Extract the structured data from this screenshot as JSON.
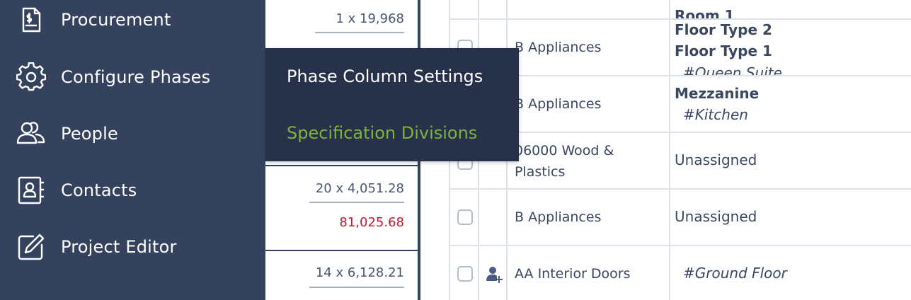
{
  "sidebar": {
    "items": [
      {
        "label": "Procurement",
        "icon": "procurement-document-icon"
      },
      {
        "label": "Configure Phases",
        "icon": "gear-icon"
      },
      {
        "label": "People",
        "icon": "people-icon"
      },
      {
        "label": "Contacts",
        "icon": "contact-book-icon"
      },
      {
        "label": "Project Editor",
        "icon": "edit-icon"
      }
    ]
  },
  "popup_menu": {
    "items": [
      {
        "label": "Phase Column Settings",
        "color": "#ffffff"
      },
      {
        "label": "Specification Divisions",
        "color": "#7fb13f"
      }
    ]
  },
  "costs": {
    "row0_qty": "1 x 19,968",
    "row3_qty": "20 x 4,051.28",
    "row3_total": "81,025.68",
    "row4_qty": "14 x 6,128.21"
  },
  "table": {
    "row0": {
      "location_bold": "Room 1"
    },
    "row1": {
      "division": "B Appliances",
      "location_bold_1": "Floor Type 2",
      "location_bold_2": "Floor Type 1",
      "location_tag": "#Queen Suite"
    },
    "row2": {
      "division": "B Appliances",
      "location_bold": "Mezzanine",
      "location_tag": "#Kitchen"
    },
    "row3": {
      "division_line1": "06000 Wood &",
      "division_line2": "Plastics",
      "location": "Unassigned"
    },
    "row4": {
      "division": "B Appliances",
      "location": "Unassigned"
    },
    "row5": {
      "division": "AA Interior Doors",
      "location_tag": "#Ground Floor"
    }
  },
  "colors": {
    "sidebar_bg": "#34425e",
    "popup_bg": "#27324a",
    "accent_green": "#7fb13f",
    "total_red": "#c4192b"
  }
}
